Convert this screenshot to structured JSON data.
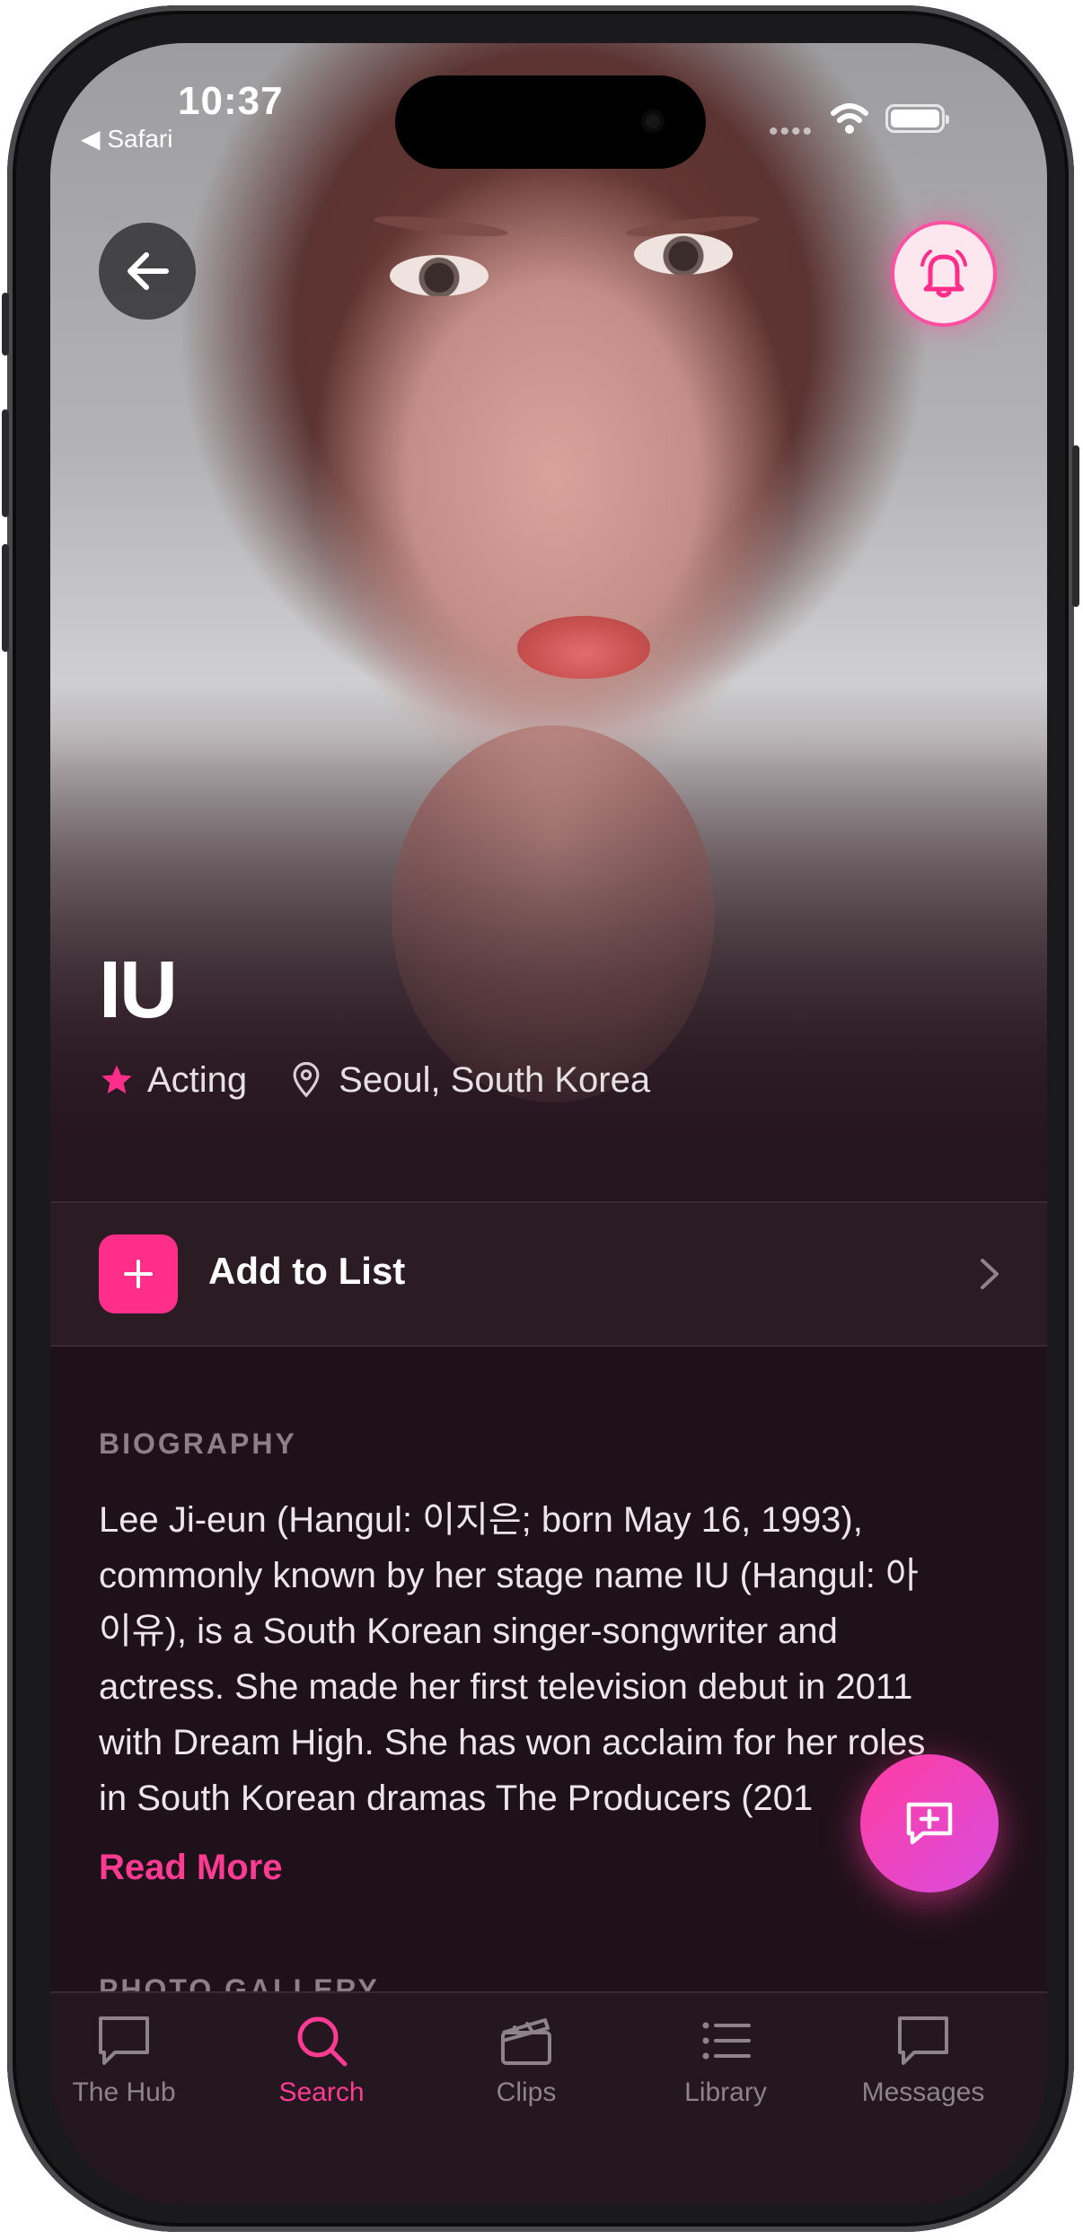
{
  "status_bar": {
    "time": "10:37",
    "back_app": "◀ Safari",
    "signal": "••••"
  },
  "hero": {
    "name": "IU",
    "category": "Acting",
    "location": "Seoul, South Korea"
  },
  "actions": {
    "add_to_list": "Add to List"
  },
  "biography": {
    "heading": "BIOGRAPHY",
    "lines": [
      "Lee Ji-eun (Hangul: 이지은; born May 16, 1993),",
      "commonly known by her stage name IU (Hangul: 아",
      "이유), is a South Korean singer-songwriter and",
      "actress. She made her first television debut in 2011",
      "with Dream High. She has won acclaim for her roles",
      "in South Korean dramas The Producers (201"
    ],
    "read_more": "Read More"
  },
  "next_section": {
    "heading": "PHOTO GALLERY"
  },
  "tabs": [
    {
      "label": "The Hub",
      "icon": "chat-bubble-icon",
      "active": false
    },
    {
      "label": "Search",
      "icon": "search-icon",
      "active": true
    },
    {
      "label": "Clips",
      "icon": "clapperboard-icon",
      "active": false
    },
    {
      "label": "Library",
      "icon": "list-icon",
      "active": false
    },
    {
      "label": "Messages",
      "icon": "message-icon",
      "active": false
    }
  ],
  "colors": {
    "accent": "#ff2e8a",
    "background": "#1f1119",
    "tab_inactive": "#8e838a"
  }
}
